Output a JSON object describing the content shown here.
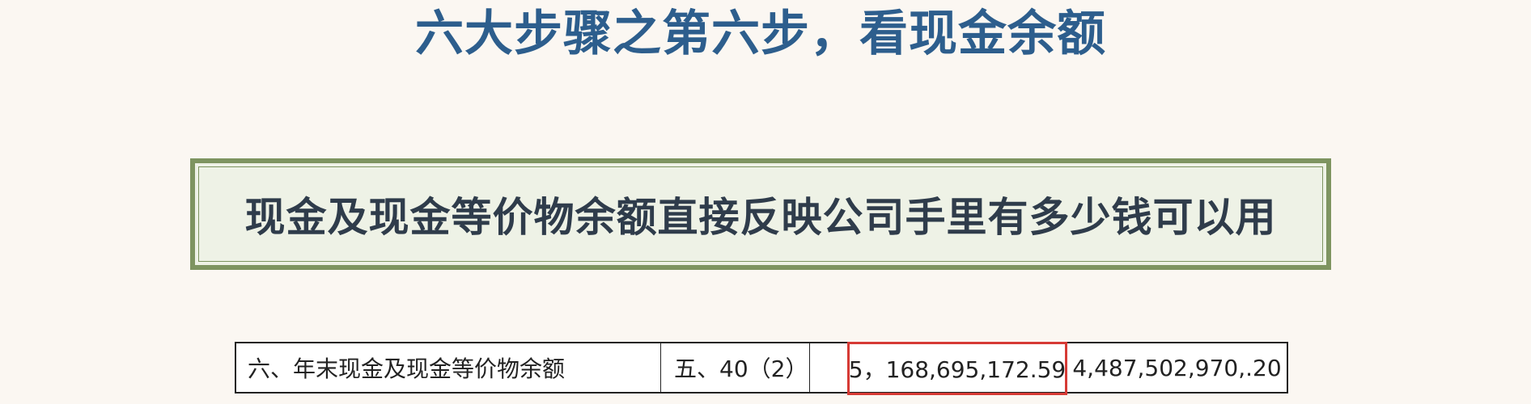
{
  "title": "六大步骤之第六步，看现金余额",
  "banner": {
    "text": "现金及现金等价物余额直接反映公司手里有多少钱可以用"
  },
  "table": {
    "row": {
      "item": "六、年末现金及现金等价物余额",
      "note": "五、40（2）",
      "blank": "",
      "current_year": "5，168,695,172.59",
      "prior_year": "4,487,502,970,.20"
    }
  },
  "colors": {
    "title": "#2d5e8d",
    "banner_border": "#7e9460",
    "banner_fill": "#eef2e6",
    "highlight_border": "#d63a35",
    "background": "#fbf7f2"
  }
}
